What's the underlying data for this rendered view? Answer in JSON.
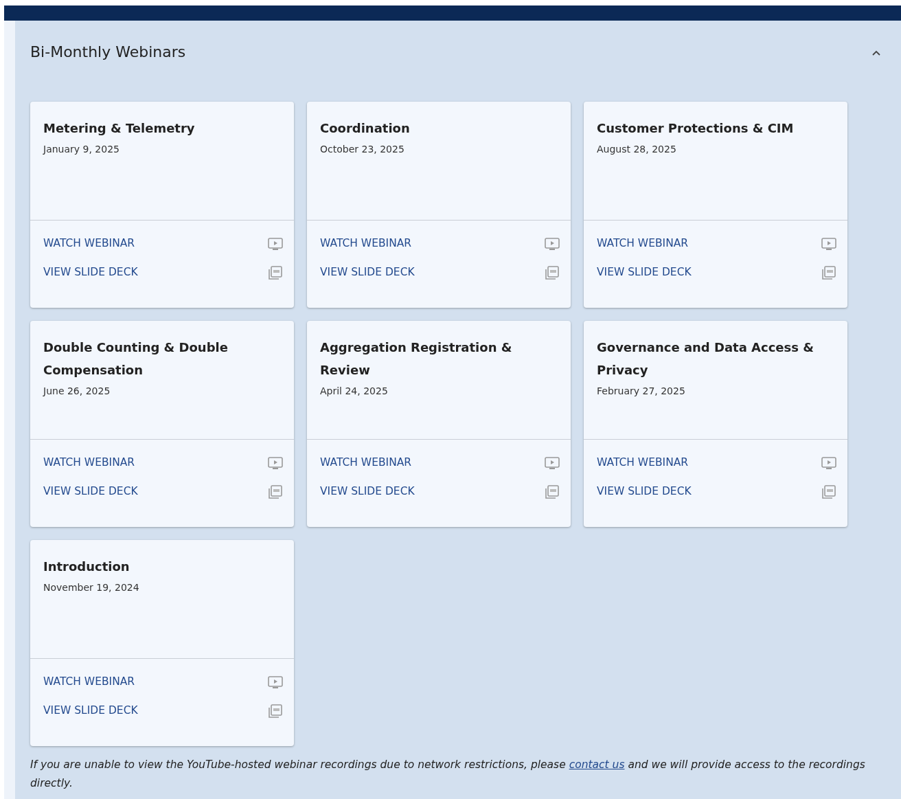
{
  "section": {
    "title": "Bi-Monthly Webinars",
    "expanded": true
  },
  "webinars": [
    {
      "title": "Metering & Telemetry",
      "date": "January 9, 2025",
      "actions": [
        "WATCH WEBINAR",
        "VIEW SLIDE DECK"
      ]
    },
    {
      "title": "Coordination",
      "date": "October 23, 2025",
      "actions": [
        "WATCH WEBINAR",
        "VIEW SLIDE DECK"
      ]
    },
    {
      "title": "Customer Protections & CIM",
      "date": "August 28, 2025",
      "actions": [
        "WATCH WEBINAR",
        "VIEW SLIDE DECK"
      ]
    },
    {
      "title": "Double Counting & Double Compensation",
      "date": "June 26, 2025",
      "actions": [
        "WATCH WEBINAR",
        "VIEW SLIDE DECK"
      ]
    },
    {
      "title": "Aggregation Registration & Review",
      "date": "April 24, 2025",
      "actions": [
        "WATCH WEBINAR",
        "VIEW SLIDE DECK"
      ]
    },
    {
      "title": "Governance and Data Access & Privacy",
      "date": "February 27, 2025",
      "actions": [
        "WATCH WEBINAR",
        "VIEW SLIDE DECK"
      ]
    },
    {
      "title": "Introduction",
      "date": "November 19, 2024",
      "actions": [
        "WATCH WEBINAR",
        "VIEW SLIDE DECK"
      ]
    }
  ],
  "note": {
    "before": "If you are unable to view the YouTube-hosted webinar recordings due to network restrictions, please",
    "link": "contact us",
    "after": "and we will provide access to the recordings directly."
  }
}
